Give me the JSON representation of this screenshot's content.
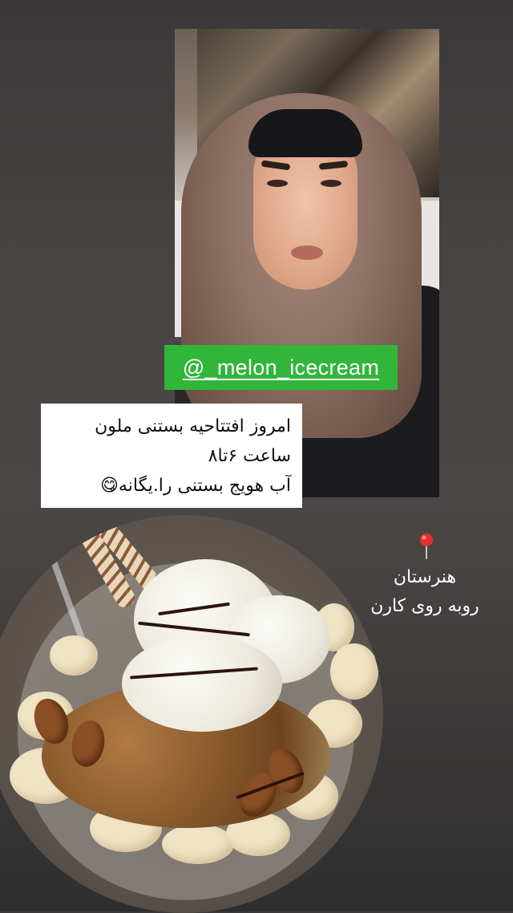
{
  "sticker": {
    "mention": "@_melon_icecream"
  },
  "caption": {
    "line1": "امروز افتتاحیه بستنی ملون",
    "line2": "ساعت ۶تا۸",
    "line3": "آب هویج بستنی را.یگانه😋"
  },
  "location": {
    "pin_icon": "round-pushpin-icon",
    "line1": "هنرستان",
    "line2": "روبه روی کارن"
  },
  "colors": {
    "mention_bg": "#31b53b",
    "caption_bg": "#ffffff",
    "background": "#454140"
  }
}
